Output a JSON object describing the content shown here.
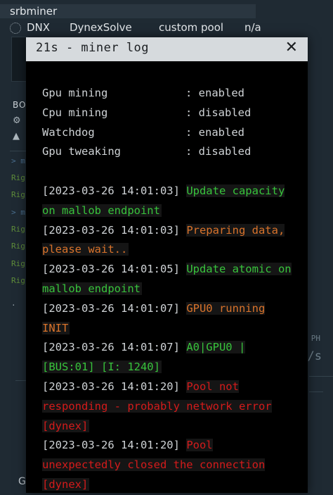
{
  "background": {
    "app_title": "srbminer",
    "row": {
      "coin": "DNX",
      "algorithm": "DynexSolve",
      "pool": "custom pool",
      "value": "n/a"
    },
    "box_label": "BO",
    "log_lines": [
      {
        "text": "> m",
        "color": "#4a6f8f"
      },
      {
        "text": "Rig",
        "color": "#5f8d3a"
      },
      {
        "text": "Rig",
        "color": "#5f8d3a"
      },
      {
        "text": "> m",
        "color": "#4a6f8f"
      },
      {
        "text": "Rig",
        "color": "#5f8d3a"
      },
      {
        "text": "Rig",
        "color": "#5f8d3a"
      },
      {
        "text": "Rig",
        "color": "#5f8d3a"
      },
      {
        "text": "Rig",
        "color": "#5f8d3a"
      }
    ],
    "right_fragments": [
      "PH",
      "/s"
    ],
    "footer": "G"
  },
  "modal": {
    "title": "21s - miner log",
    "close_icon": "close-icon",
    "settings": [
      {
        "key": "Gpu mining",
        "value": ": enabled"
      },
      {
        "key": "Cpu mining",
        "value": ": disabled"
      },
      {
        "key": "Watchdog",
        "value": ": enabled"
      },
      {
        "key": "Gpu tweaking",
        "value": ": disabled"
      }
    ],
    "entries": [
      {
        "ts": "[2023-03-26 14:01:03]",
        "msg": "Update capacity on mallob endpoint",
        "level": "green"
      },
      {
        "ts": "[2023-03-26 14:01:03]",
        "msg": "Preparing data, please wait..",
        "level": "orange"
      },
      {
        "ts": "[2023-03-26 14:01:05]",
        "msg": "Update atomic on mallob endpoint",
        "level": "green"
      },
      {
        "ts": "[2023-03-26 14:01:07]",
        "msg": "GPU0 running INIT",
        "level": "orange"
      },
      {
        "ts": "[2023-03-26 14:01:07]",
        "msg": "A0|GPU0 | [BUS:01] [I:        1240]",
        "level": "green"
      },
      {
        "ts": "[2023-03-26 14:01:20]",
        "msg": "Pool not responding - probably network error [dynex]",
        "level": "red"
      },
      {
        "ts": "[2023-03-26 14:01:20]",
        "msg": "Pool unexpectedly closed the connection [dynex]",
        "level": "red"
      }
    ],
    "colors": {
      "green": "#38c43c",
      "orange": "#d9732b",
      "red": "#d41b1b"
    }
  }
}
